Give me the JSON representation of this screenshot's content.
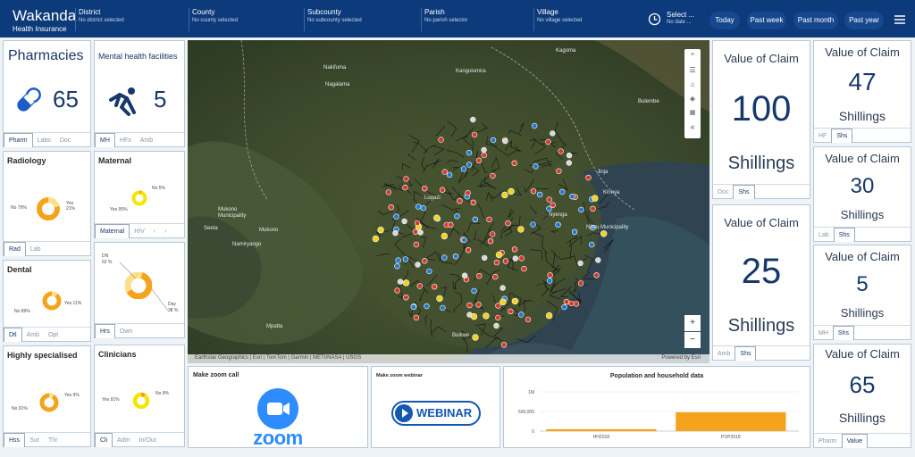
{
  "header": {
    "app_title": "Wakanda",
    "app_subtitle": "Health Insurance",
    "filters": [
      {
        "label": "District",
        "value": "No district selected"
      },
      {
        "label": "County",
        "value": "No county selected"
      },
      {
        "label": "Subcounty",
        "value": "No subcounty selected"
      },
      {
        "label": "Parish",
        "value": "No parish selector"
      },
      {
        "label": "Village",
        "value": "No village selected"
      }
    ],
    "date_select": {
      "label": "Select ...",
      "value": "No date ..."
    },
    "ranges": [
      "Today",
      "Past week",
      "Past month",
      "Past year"
    ]
  },
  "pharmacies": {
    "title": "Pharmacies",
    "count": "65",
    "tabs": [
      "Pharm",
      "Labs",
      "Doc"
    ]
  },
  "mental": {
    "title": "Mental health facilities",
    "count": "5",
    "tabs": [
      "MH",
      "HFs",
      "Amb"
    ]
  },
  "radiology": {
    "title": "Radiology",
    "yes": "Yes 21%",
    "no": "No 79%",
    "tabs": [
      "Rad",
      "Lab"
    ]
  },
  "maternal": {
    "title": "Maternal",
    "yes": "Yes 95%",
    "no": "No 5%",
    "tabs": [
      "Maternal",
      "HIV"
    ]
  },
  "dental": {
    "title": "Dental",
    "yes": "Yes 11%",
    "no": "No 89%",
    "tabs": [
      "Dtl",
      "Amb",
      "Opt"
    ]
  },
  "hours": {
    "dn": "DN 62 %",
    "day": "Day 38 %",
    "tabs": [
      "Hrs",
      "Own"
    ]
  },
  "specialised": {
    "title": "Highly specialised",
    "yes": "Yes 9%",
    "no": "No 91%",
    "tabs": [
      "Hss",
      "Sur",
      "Thr"
    ]
  },
  "clinicians": {
    "title": "Clinicians",
    "yes": "Yes 91%",
    "no": "No 9%",
    "tabs": [
      "Cli",
      "Adm",
      "In/Out"
    ]
  },
  "map": {
    "places": [
      "Kagoma",
      "Nakifuma",
      "Kangulumira",
      "Nagalama",
      "Bulembe",
      "Jinja",
      "Kirinya",
      "Nyenga",
      "Mukono Municipality",
      "Seeta",
      "Mukono",
      "Njeru Municipality",
      "Namiryango",
      "Lugazi",
      "Buikwe",
      "Mpatta"
    ],
    "attribution": "Earthstar Geographics | Esri | TomTom | Garmin | METI/NASA | USGS",
    "powered": "Powered by Esri",
    "zoom_in": "+",
    "zoom_out": "−"
  },
  "zoom_call": {
    "title": "Make zoom call",
    "logo_text": "zoom"
  },
  "webinar": {
    "title": "Make zoom webinar",
    "logo_text": "WEBINAR"
  },
  "population": {
    "title": "Population and household data",
    "yticks": [
      "1M",
      "500,000",
      "0"
    ]
  },
  "chart_data": {
    "type": "bar",
    "title": "Population and household data",
    "categories": [
      "HH2018",
      "POP2018"
    ],
    "values": [
      50000,
      480000
    ],
    "ylim": [
      0,
      1000000
    ],
    "color": "#f5a31a"
  },
  "values_mid": [
    {
      "title": "Value of Claim",
      "amount": "100",
      "unit": "Shillings",
      "tabs": [
        "Doc",
        "Shs"
      ]
    },
    {
      "title": "Value of Claim",
      "amount": "25",
      "unit": "Shillings",
      "tabs": [
        "Amb",
        "Shs"
      ]
    }
  ],
  "values_right": [
    {
      "title": "Value of Claim",
      "amount": "47",
      "unit": "Shillings",
      "tabs": [
        "HF",
        "Shs"
      ]
    },
    {
      "title": "Value of Claim",
      "amount": "30",
      "unit": "Shillings",
      "tabs": [
        "Lab",
        "Shs"
      ]
    },
    {
      "title": "Value of Claim",
      "amount": "5",
      "unit": "Shillings",
      "tabs": [
        "MH",
        "Shs"
      ]
    },
    {
      "title": "Value of Claim",
      "amount": "65",
      "unit": "Shillings",
      "tabs": [
        "Pharm",
        "Value"
      ]
    }
  ],
  "colors": {
    "header": "#0c3a7a",
    "accent": "#16386a",
    "donut": "#f5a31a",
    "donut_yellow": "#f3e600",
    "zoom_blue": "#2d8cff",
    "webinar_blue": "#1458b0"
  }
}
